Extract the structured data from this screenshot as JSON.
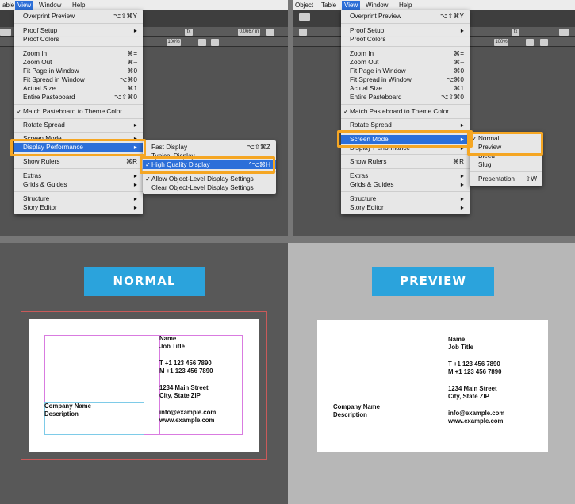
{
  "left_screen": {
    "menubar": [
      "able",
      "View",
      "Window",
      "Help"
    ],
    "view_menu": [
      {
        "label": "Overprint Preview",
        "shortcut": "⌥⇧⌘Y"
      },
      {
        "label": "Proof Setup",
        "shortcut": "▸"
      },
      {
        "label": "Proof Colors",
        "shortcut": ""
      },
      {
        "label": "Zoom In",
        "shortcut": "⌘="
      },
      {
        "label": "Zoom Out",
        "shortcut": "⌘–"
      },
      {
        "label": "Fit Page in Window",
        "shortcut": "⌘0"
      },
      {
        "label": "Fit Spread in Window",
        "shortcut": "⌥⌘0"
      },
      {
        "label": "Actual Size",
        "shortcut": "⌘1"
      },
      {
        "label": "Entire Pasteboard",
        "shortcut": "⌥⇧⌘0"
      },
      {
        "label": "Match Pasteboard to Theme Color",
        "shortcut": ""
      },
      {
        "label": "Rotate Spread",
        "shortcut": "▸"
      },
      {
        "label": "Screen Mode",
        "shortcut": "▸"
      },
      {
        "label": "Display Performance",
        "shortcut": "▸"
      },
      {
        "label": "Show Rulers",
        "shortcut": "⌘R"
      },
      {
        "label": "Extras",
        "shortcut": "▸"
      },
      {
        "label": "Grids & Guides",
        "shortcut": "▸"
      },
      {
        "label": "Structure",
        "shortcut": "▸"
      },
      {
        "label": "Story Editor",
        "shortcut": "▸"
      }
    ],
    "submenu": [
      {
        "label": "Fast Display",
        "shortcut": "⌥⇧⌘Z"
      },
      {
        "label": "Typical Display",
        "shortcut": ""
      },
      {
        "label": "High Quality Display",
        "shortcut": "^⌥⌘H"
      },
      {
        "label": "Allow Object-Level Display Settings",
        "shortcut": ""
      },
      {
        "label": "Clear Object-Level Display Settings",
        "shortcut": ""
      }
    ],
    "toolbar_value": "0.0667 in",
    "zoom": "100%"
  },
  "right_screen": {
    "menubar": [
      "Object",
      "Table",
      "View",
      "Window",
      "Help"
    ],
    "view_menu": [
      {
        "label": "Overprint Preview",
        "shortcut": "⌥⇧⌘Y"
      },
      {
        "label": "Proof Setup",
        "shortcut": "▸"
      },
      {
        "label": "Proof Colors",
        "shortcut": ""
      },
      {
        "label": "Zoom In",
        "shortcut": "⌘="
      },
      {
        "label": "Zoom Out",
        "shortcut": "⌘–"
      },
      {
        "label": "Fit Page in Window",
        "shortcut": "⌘0"
      },
      {
        "label": "Fit Spread in Window",
        "shortcut": "⌥⌘0"
      },
      {
        "label": "Actual Size",
        "shortcut": "⌘1"
      },
      {
        "label": "Entire Pasteboard",
        "shortcut": "⌥⇧⌘0"
      },
      {
        "label": "Match Pasteboard to Theme Color",
        "shortcut": ""
      },
      {
        "label": "Rotate Spread",
        "shortcut": "▸"
      },
      {
        "label": "Screen Mode",
        "shortcut": "▸"
      },
      {
        "label": "Display Performance",
        "shortcut": "▸"
      },
      {
        "label": "Show Rulers",
        "shortcut": "⌘R"
      },
      {
        "label": "Extras",
        "shortcut": "▸"
      },
      {
        "label": "Grids & Guides",
        "shortcut": "▸"
      },
      {
        "label": "Structure",
        "shortcut": "▸"
      },
      {
        "label": "Story Editor",
        "shortcut": "▸"
      }
    ],
    "submenu": [
      {
        "label": "Normal",
        "shortcut": ""
      },
      {
        "label": "Preview",
        "shortcut": ""
      },
      {
        "label": "Bleed",
        "shortcut": ""
      },
      {
        "label": "Slug",
        "shortcut": ""
      },
      {
        "label": "Presentation",
        "shortcut": "⇧W"
      }
    ],
    "zoom": "100%"
  },
  "normal_label": "NORMAL",
  "preview_label": "PREVIEW",
  "card": {
    "name": "Name",
    "job_title": "Job Title",
    "phone_t": "T  +1 123 456 7890",
    "phone_m": "M +1 123 456 7890",
    "address1": "1234 Main Street",
    "address2": "City, State ZIP",
    "email": "info@example.com",
    "web": "www.example.com",
    "company": "Company Name",
    "description": "Description"
  },
  "colors": {
    "accent_blue": "#2ba3dc",
    "highlight_orange": "#f5a623",
    "menu_selected": "#2c6fd9",
    "guide_magenta": "#d97be0",
    "guide_cyan": "#7ecbe8",
    "bleed_red": "#c95a5a"
  }
}
